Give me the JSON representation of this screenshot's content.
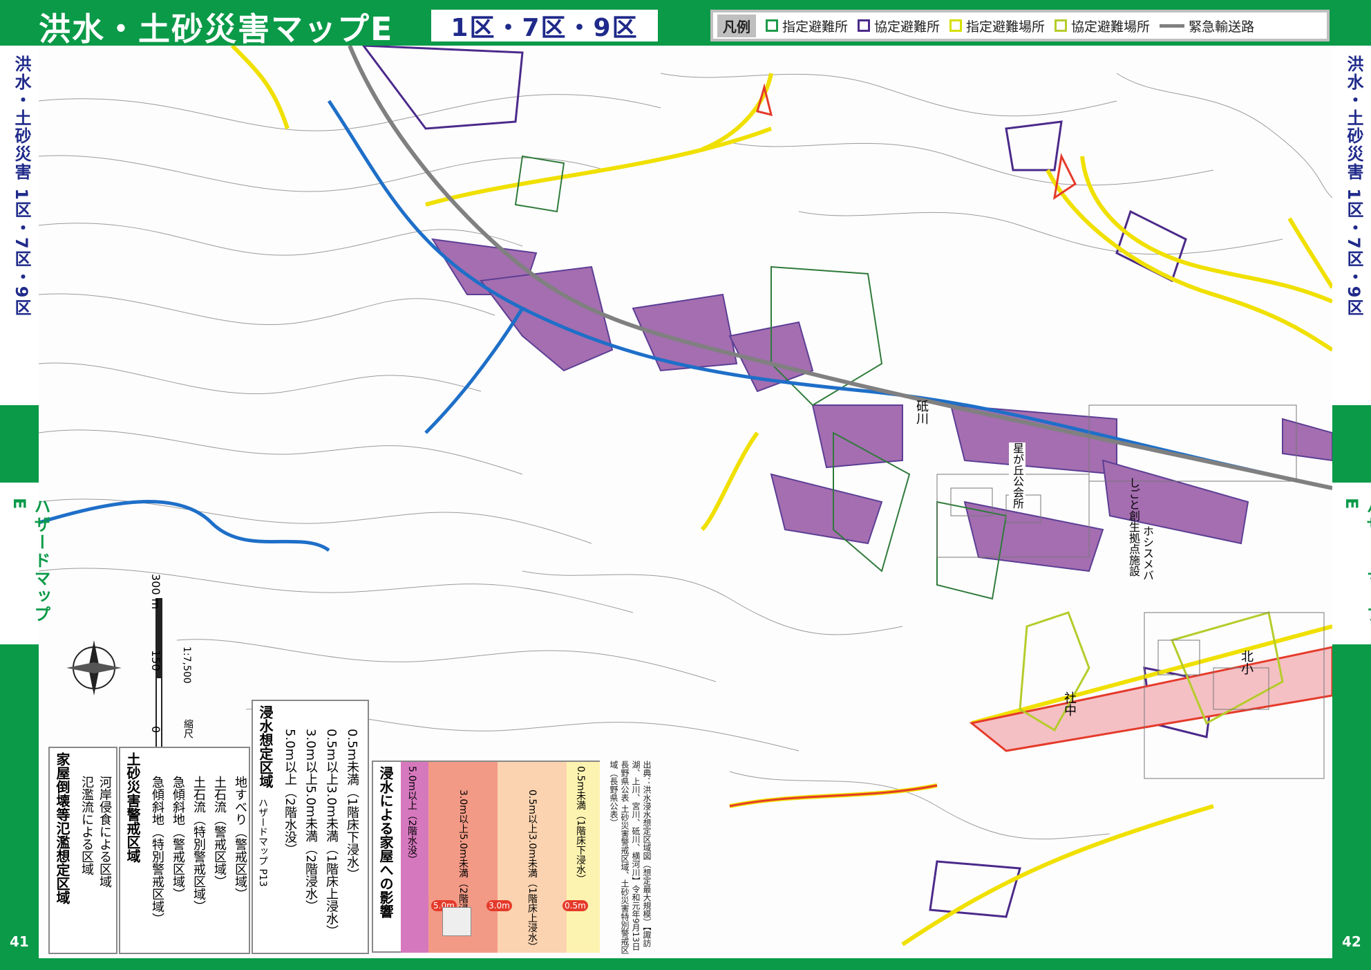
{
  "header": {
    "title": "洪水・土砂災害マップE",
    "areas": "1区・7区・9区"
  },
  "legend": {
    "heading": "凡例",
    "items": [
      {
        "label": "指定避難所",
        "color": "#1f9a4a"
      },
      {
        "label": "協定避難所",
        "color": "#4b2a8a"
      },
      {
        "label": "指定避難場所",
        "color": "#d6e000"
      },
      {
        "label": "協定避難場所",
        "color": "#b5cc2a"
      },
      {
        "label": "緊急輸送路",
        "color": "#808080"
      }
    ]
  },
  "side": {
    "left_top": "洪水・土砂災害 1区・7区・9区",
    "left_bottom": "ハザードマップE",
    "right_top": "洪水・土砂災害 1区・7区・9区",
    "right_bottom": "ハザードマップE",
    "page_left": "41",
    "page_right": "42"
  },
  "map_labels": {
    "river": "砥川",
    "hall": "星が丘公会所",
    "facility": "しごと創生拠点施設",
    "facility2": "ホシスメバ",
    "school1": "社中",
    "school2": "北小"
  },
  "scale": {
    "ticks": [
      "0",
      "150",
      "300 m"
    ],
    "ratio": "1:7,500",
    "label": "縮尺"
  },
  "hazard_legend": {
    "flood_collapse_title": "家屋倒壊等氾濫想定区域",
    "flood_collapse_items": [
      "氾濫流による区域",
      "河岸侵食による区域"
    ],
    "sediment_title": "土砂災害警戒区域",
    "sediment_items": [
      "急傾斜地（特別警戒区域）",
      "急傾斜地（警戒区域）",
      "土石流（特別警戒区域）",
      "土石流（警戒区域）",
      "地すべり（警戒区域）"
    ],
    "inundation_title": "浸水想定区域",
    "inundation_ref": "ハザードマップ P13",
    "inundation_items": [
      "5.0m以上（2階水没）",
      "3.0m以上5.0m未満（2階浸水）",
      "0.5m以上3.0m未満（1階床上浸水）",
      "0.5m未満（1階床下浸水）"
    ]
  },
  "impact": {
    "title": "浸水による家屋への影響",
    "columns": [
      "5.0m以上（2階水没）",
      "3.0m以上5.0m未満（2階浸水）",
      "0.5m以上3.0m未満（1階床上浸水）",
      "0.5m未満（1階床下浸水）"
    ],
    "depth_marks": [
      "5.0m",
      "3.0m",
      "0.5m"
    ]
  },
  "sources": "出典：洪水浸水想定区域図（想定最大規模）【諏訪湖、上川、宮川、砥川、横河川】令和元年9月13日 長野県公表 土砂災害警戒区域、土砂災害特別警戒区域（長野県公表）"
}
